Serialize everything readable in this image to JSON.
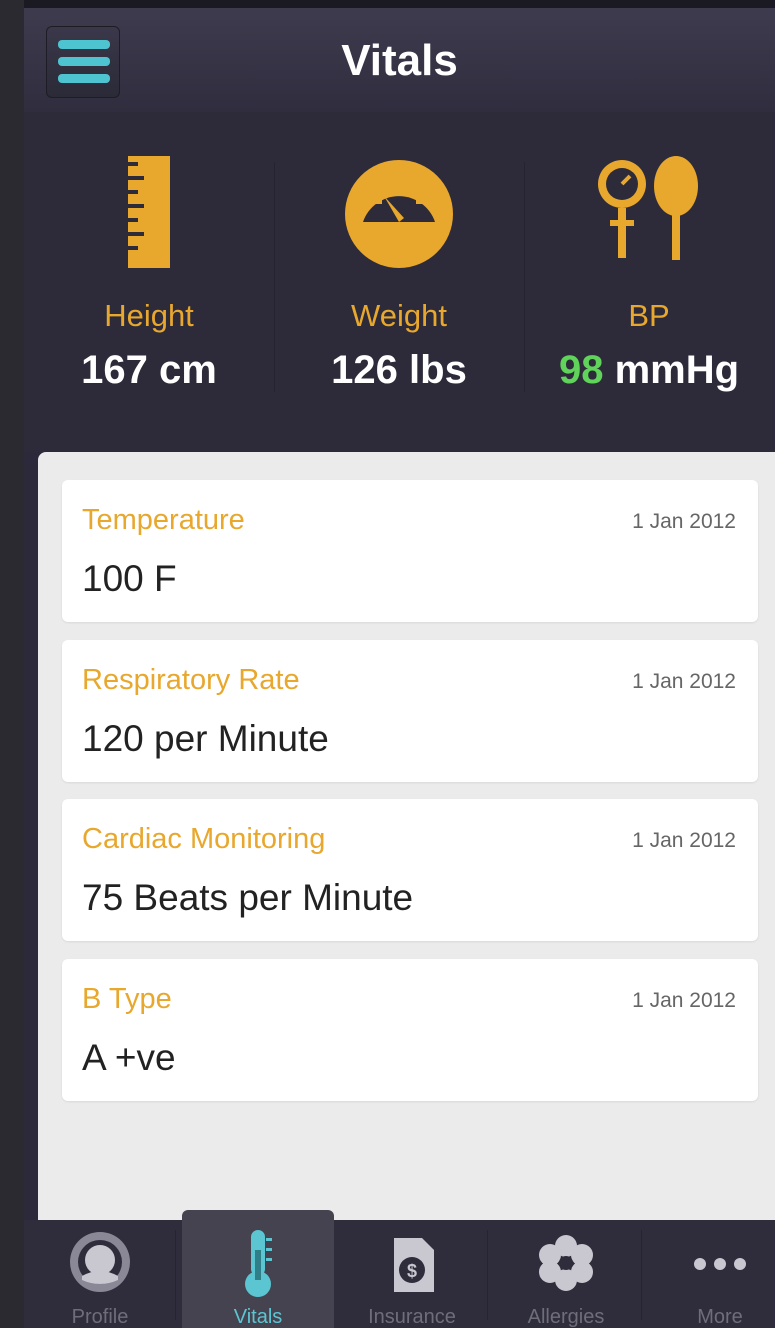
{
  "header": {
    "title": "Vitals",
    "menu_icon": "hamburger-icon"
  },
  "stats": [
    {
      "icon": "ruler-icon",
      "label": "Height",
      "value": "167 cm"
    },
    {
      "icon": "gauge-icon",
      "label": "Weight",
      "value": "126 lbs"
    },
    {
      "icon": "bp-meter-icon",
      "label": "BP",
      "value_highlight": "98",
      "value_unit": " mmHg"
    }
  ],
  "records": [
    {
      "title": "Temperature",
      "date": "1 Jan 2012",
      "value": "100 F"
    },
    {
      "title": "Respiratory Rate",
      "date": "1 Jan 2012",
      "value": "120 per Minute"
    },
    {
      "title": "Cardiac Monitoring",
      "date": "1 Jan 2012",
      "value": "75 Beats per Minute"
    },
    {
      "title": "B Type",
      "date": "1 Jan 2012",
      "value": "A +ve"
    }
  ],
  "tabs": [
    {
      "label": "Profile",
      "icon": "profile-icon"
    },
    {
      "label": "Vitals",
      "icon": "thermometer-icon",
      "active": true
    },
    {
      "label": "Insurance",
      "icon": "dollar-document-icon"
    },
    {
      "label": "Allergies",
      "icon": "flower-icon"
    },
    {
      "label": "More",
      "icon": "more-dots-icon"
    }
  ],
  "colors": {
    "accent": "#e8a72d",
    "teal": "#5bc6d2",
    "green": "#5fd35a",
    "dark_bg": "#2c2a3a"
  }
}
